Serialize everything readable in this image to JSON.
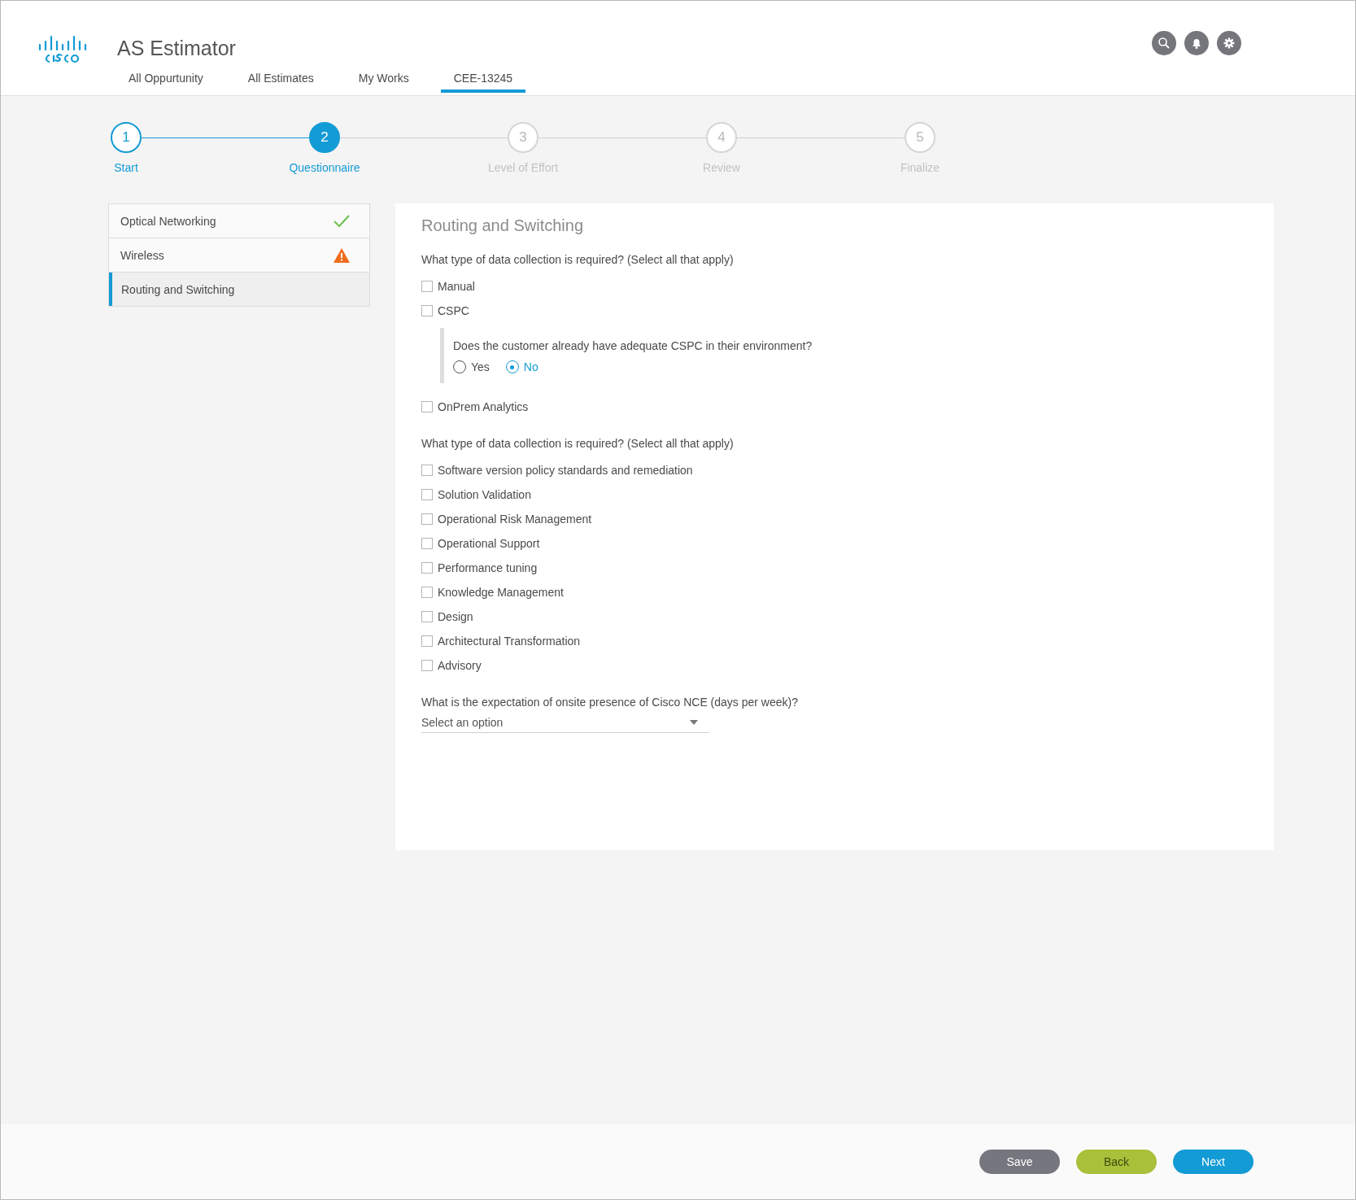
{
  "app": {
    "title": "AS Estimator"
  },
  "header_icons": [
    {
      "kind": "search"
    },
    {
      "kind": "bell"
    },
    {
      "kind": "gear"
    }
  ],
  "tabs": [
    {
      "label": "All Oppurtunity",
      "selected": false
    },
    {
      "label": "All Estimates",
      "selected": false
    },
    {
      "label": "My Works",
      "selected": false
    },
    {
      "label": "CEE-13245",
      "selected": true
    }
  ],
  "steps": [
    {
      "number": "1",
      "label": "Start",
      "completed": true,
      "selected": false
    },
    {
      "number": "2",
      "label": "Questionnaire",
      "completed": false,
      "selected": true
    },
    {
      "number": "3",
      "label": "Level of Effort",
      "completed": false,
      "selected": false
    },
    {
      "number": "4",
      "label": "Review",
      "completed": false,
      "selected": false
    },
    {
      "number": "5",
      "label": "Finalize",
      "completed": false,
      "selected": false
    }
  ],
  "sections": [
    {
      "label": "Optical Networking",
      "complete": true,
      "warning": false,
      "selected": false
    },
    {
      "label": "Wireless",
      "complete": false,
      "warning": true,
      "selected": false
    },
    {
      "label": "Routing and Switching",
      "complete": false,
      "warning": false,
      "selected": true
    }
  ],
  "form": {
    "title": "Routing and Switching",
    "questions": [
      {
        "kind": "checkboxes",
        "text": "What type of data collection is required? (Select all that apply)",
        "options": [
          {
            "label": "Manual",
            "checked": false
          },
          {
            "label": "CSPC",
            "checked": false,
            "followup": {
              "text": "Does the customer already have adequate CSPC in their environment?",
              "choices": [
                {
                  "label": "Yes",
                  "selected": false
                },
                {
                  "label": "No",
                  "selected": true
                }
              ]
            }
          },
          {
            "label": "OnPrem Analytics",
            "checked": false
          }
        ]
      },
      {
        "kind": "checkboxes",
        "text": "What type of data collection is required? (Select all that apply)",
        "options": [
          {
            "label": "Software version policy standards and remediation",
            "checked": false
          },
          {
            "label": "Solution Validation",
            "checked": false
          },
          {
            "label": "Operational Risk Management",
            "checked": false
          },
          {
            "label": "Operational Support",
            "checked": false
          },
          {
            "label": "Performance tuning",
            "checked": false
          },
          {
            "label": "Knowledge Management",
            "checked": false
          },
          {
            "label": "Design",
            "checked": false
          },
          {
            "label": "Architectural Transformation",
            "checked": false
          },
          {
            "label": "Advisory",
            "checked": false
          }
        ]
      },
      {
        "kind": "select",
        "text": "What is the expectation of onsite presence of Cisco NCE (days per week)?",
        "placeholder": "Select an option"
      }
    ]
  },
  "buttons": [
    {
      "label": "Save",
      "kind": "neutral"
    },
    {
      "label": "Back",
      "kind": "secondary"
    },
    {
      "label": "Next",
      "kind": "primary"
    }
  ]
}
